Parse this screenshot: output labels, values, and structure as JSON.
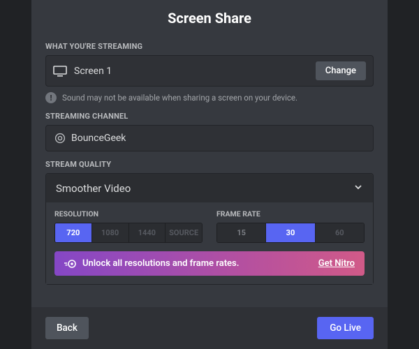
{
  "title": "Screen Share",
  "streaming": {
    "label": "WHAT YOU'RE STREAMING",
    "source": "Screen 1",
    "change": "Change",
    "warning": "Sound may not be available when sharing a screen on your device."
  },
  "channel": {
    "label": "STREAMING CHANNEL",
    "name": "BounceGeek"
  },
  "quality": {
    "label": "STREAM QUALITY",
    "preset": "Smoother Video",
    "resolution_label": "RESOLUTION",
    "resolutions": [
      "720",
      "1080",
      "1440",
      "SOURCE"
    ],
    "resolution_selected": "720",
    "framerate_label": "FRAME RATE",
    "framerates": [
      "15",
      "30",
      "60"
    ],
    "framerate_selected": "30",
    "nitro_text": "Unlock all resolutions and frame rates.",
    "nitro_cta": "Get Nitro"
  },
  "footer": {
    "back": "Back",
    "golive": "Go Live"
  }
}
